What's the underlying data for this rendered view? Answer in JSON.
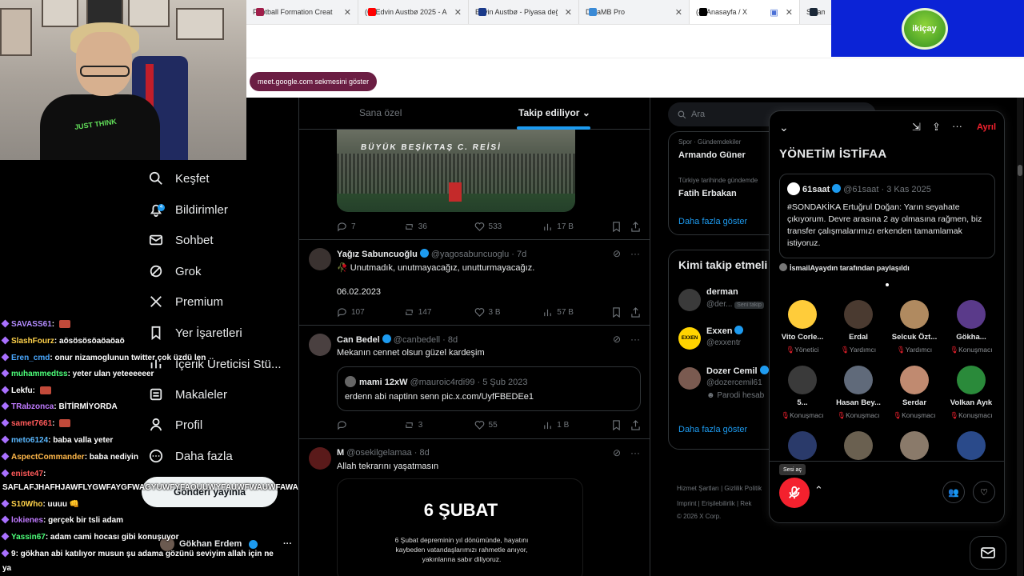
{
  "browser": {
    "tabs": [
      {
        "label": "Football Formation Creat",
        "color": "#a01e4a"
      },
      {
        "label": "(6) Edvin Austbø 2025 - A",
        "color": "#ff0000"
      },
      {
        "label": "Edvin Austbø - Piyasa değ",
        "color": "#1a3a8a"
      },
      {
        "label": "DataMB Pro",
        "color": "#3a8ad6"
      },
      {
        "label": "(4) Anasayfa / X",
        "color": "#000000"
      },
      {
        "label": "Steam",
        "color": "#1b2838"
      }
    ],
    "tooltip": "meet.google.com sekmesini göster",
    "sponsor_logo": "ikiçay"
  },
  "webcam": {
    "shirt_text": "JUST THINK"
  },
  "nav": {
    "items": [
      {
        "label": "Keşfet",
        "icon": "search-icon"
      },
      {
        "label": "Bildirimler",
        "icon": "bell-icon",
        "badge": "4"
      },
      {
        "label": "Sohbet",
        "icon": "mail-icon"
      },
      {
        "label": "Grok",
        "icon": "grok-icon"
      },
      {
        "label": "Premium",
        "icon": "x-logo-icon"
      },
      {
        "label": "Yer İşaretleri",
        "icon": "bookmark-icon"
      },
      {
        "label": "İçerik Üreticisi Stü...",
        "icon": "studio-icon"
      },
      {
        "label": "Makaleler",
        "icon": "articles-icon"
      },
      {
        "label": "Profil",
        "icon": "profile-icon"
      },
      {
        "label": "Daha fazla",
        "icon": "more-circle-icon"
      }
    ],
    "post_button": "Gönderi yayınla",
    "profile_name": "Gökhan Erdem",
    "profile_more": "···"
  },
  "chat": [
    {
      "user": "SAVASS61",
      "color": "#b48cff",
      "text": ": ",
      "emote": true
    },
    {
      "user": "SlashFourz",
      "color": "#ffd24a",
      "text": ": aösösösöaöaöaö"
    },
    {
      "user": "Eren_cmd",
      "color": "#4aa8ff",
      "text": ": onur nizamoglunun twitter çok üzdü len"
    },
    {
      "user": "muhammedtss",
      "color": "#4dff7a",
      "text": ": yeter ulan yeteeeeeer"
    },
    {
      "user": "Lekfu",
      "color": "#ffffff",
      "text": ": ",
      "emote": true
    },
    {
      "user": "TRabzonca",
      "color": "#c07bff",
      "text": ": BİTİRMİYORDA"
    },
    {
      "user": "samet7661",
      "color": "#ff5a5a",
      "text": ": ",
      "emote": true
    },
    {
      "user": "meto6124",
      "color": "#5ab8ff",
      "text": ": baba valla yeter"
    },
    {
      "user": "AspectCommander",
      "color": "#ffb84a",
      "text": ": baba nediyin"
    },
    {
      "user": "eniste47",
      "color": "#ff5a5a",
      "text": ":"
    },
    {
      "user": "",
      "color": "#ffffff",
      "text": "SAFLAFJHAFHJAWFLYGWFAYGFWAGYUWFYFAOUUWYFAUWFWAUWFAWAF"
    },
    {
      "user": "S10Who",
      "color": "#ffd24a",
      "text": ": uuuu 👊"
    },
    {
      "user": "lokienes",
      "color": "#c07bff",
      "text": ": gerçek bir tsli adam"
    },
    {
      "user": "Yassin67",
      "color": "#4dff7a",
      "text": ": adam cami hocası gibi konuşuyor"
    },
    {
      "user": "9",
      "color": "#ffffff",
      "text": ": gökhan abi katılıyor musun şu adama gözünü seviyim allah için ne"
    },
    {
      "user": "",
      "color": "#ffffff",
      "text": "ya"
    }
  ],
  "timeline": {
    "tab_for_you": "Sana özel",
    "tab_following": "Takip ediliyor",
    "media_banner": "BÜYÜK BEŞİKTAŞ C. REİSİ",
    "post1_stats": {
      "reply": "7",
      "repost": "36",
      "like": "533",
      "views": "17 B"
    },
    "post2": {
      "name": "Yağız Sabuncuoğlu",
      "handle": "@yagosabuncuoglu · 7d",
      "text": "🥀 Unutmadık, unutmayacağız, unutturmayacağız.",
      "date": "06.02.2023",
      "stats": {
        "reply": "107",
        "repost": "147",
        "like": "3 B",
        "views": "57 B"
      }
    },
    "post3": {
      "name": "Can Bedel",
      "handle": "@canbedell · 8d",
      "text": "Mekanın cennet olsun güzel kardeşim",
      "quote_name": "mami 12xW",
      "quote_handle": "@mauroic4rdi99 · 5 Şub 2023",
      "quote_text": "erdenn abi naptinn senn pic.x.com/UyfFBEDEe1",
      "stats": {
        "reply": "",
        "repost": "3",
        "like": "55",
        "views": "1 B"
      }
    },
    "post4": {
      "name": "M",
      "handle": "@osekilgelamaa · 8d",
      "text": "Allah tekrarını yaşatmasın",
      "image_title": "6 ŞUBAT",
      "image_text": "6 Şubat depreminin yıl dönümünde, hayatını kaybeden vatandaşlarımızı rahmetle anıyor, yakınlarına sabır diliyoruz."
    }
  },
  "right": {
    "search_placeholder": "Ara",
    "trends": [
      {
        "meta": "Spor · Gündemdekiler",
        "name": "Armando Güner"
      },
      {
        "meta": "Türkiye tarihinde gündemde",
        "name": "Fatih Erbakan"
      }
    ],
    "show_more": "Daha fazla göster",
    "follow_title": "Kimi takip etmeli",
    "follows": [
      {
        "name": "derman",
        "handle": "@der...",
        "tag": "Seni takip",
        "color": "#3a3a3a"
      },
      {
        "name": "Exxen",
        "handle": "@exxentr",
        "tag": "",
        "color": "#ffd400"
      },
      {
        "name": "Dozer Cemil",
        "handle": "@dozercemil61",
        "tag": "Parodi hesab",
        "color": "#7a5a50"
      }
    ],
    "show_more_2": "Daha fazla göster",
    "footer": [
      "Hizmet Şartları | Gizlilik Politik",
      "Imprint | Erişilebilirlik | Rek",
      "© 2026 X Corp."
    ]
  },
  "space": {
    "leave": "Ayrıl",
    "title": "YÖNETİM İSTİFAA",
    "tweet_name": "61saat",
    "tweet_handle": "@61saat · 3 Kas 2025",
    "tweet_text": "#SONDAKİKA Ertuğrul Doğan: Yarın seyahate çıkıyorum. Devre arasına 2 ay olmasına rağmen, biz transfer çalışmalarımızı erkenden tamamlamak istiyoruz.",
    "shared_by": "İsmailAyaydın tarafından paylaşıldı",
    "people": [
      {
        "name": "Vito Corle...",
        "role": "Yönetici",
        "color": "#ffcc3a"
      },
      {
        "name": "Erdal",
        "role": "Yardımcı",
        "color": "#4a3a30"
      },
      {
        "name": "Selcuk Özt...",
        "role": "Yardımcı",
        "color": "#b08a60"
      },
      {
        "name": "Gökha...",
        "role": "Konuşmacı",
        "color": "#5a3a8a"
      },
      {
        "name": "5...",
        "role": "Konuşmacı",
        "color": "#3a3a3a"
      },
      {
        "name": "Hasan Bey...",
        "role": "Konuşmacı",
        "color": "#606a7a"
      },
      {
        "name": "Serdar",
        "role": "Konuşmacı",
        "color": "#c08a70"
      },
      {
        "name": "Volkan Ayık",
        "role": "Konuşmacı",
        "color": "#2a8a3a"
      }
    ],
    "unmute_tip": "Sesi aç"
  }
}
